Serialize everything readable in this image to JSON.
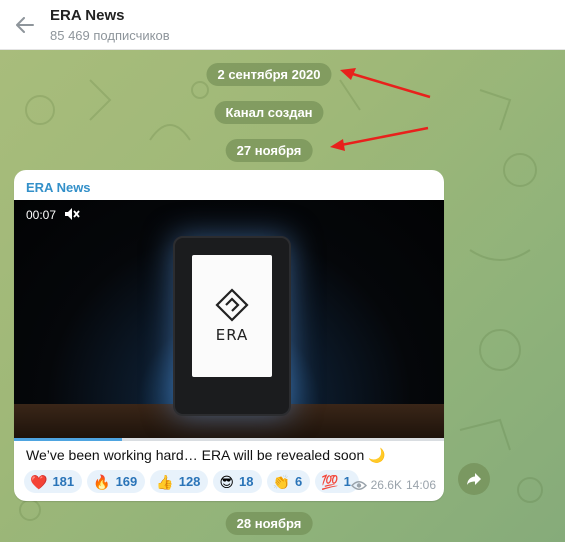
{
  "header": {
    "title": "ERA News",
    "subtitle": "85 469 подписчиков",
    "back_icon": "arrow-left-icon"
  },
  "service_messages": [
    "2 сентября 2020",
    "Канал создан",
    "27 ноября",
    "28 ноября"
  ],
  "post": {
    "author": "ERA News",
    "video": {
      "time": "00:07",
      "progress": 0.25,
      "brand": "ERA"
    },
    "caption": "We’ve been working hard… ERA will be revealed soon 🌙",
    "reactions": [
      {
        "emoji": "❤️",
        "count": "181"
      },
      {
        "emoji": "🔥",
        "count": "169"
      },
      {
        "emoji": "👍",
        "count": "128"
      },
      {
        "emoji": "😎",
        "count": "18"
      },
      {
        "emoji": "👏",
        "count": "6"
      },
      {
        "emoji": "💯",
        "count": "1"
      }
    ],
    "views": "26.6K",
    "time": "14:06"
  },
  "colors": {
    "annotation_arrow": "#e8211c",
    "accent": "#3390c9"
  }
}
